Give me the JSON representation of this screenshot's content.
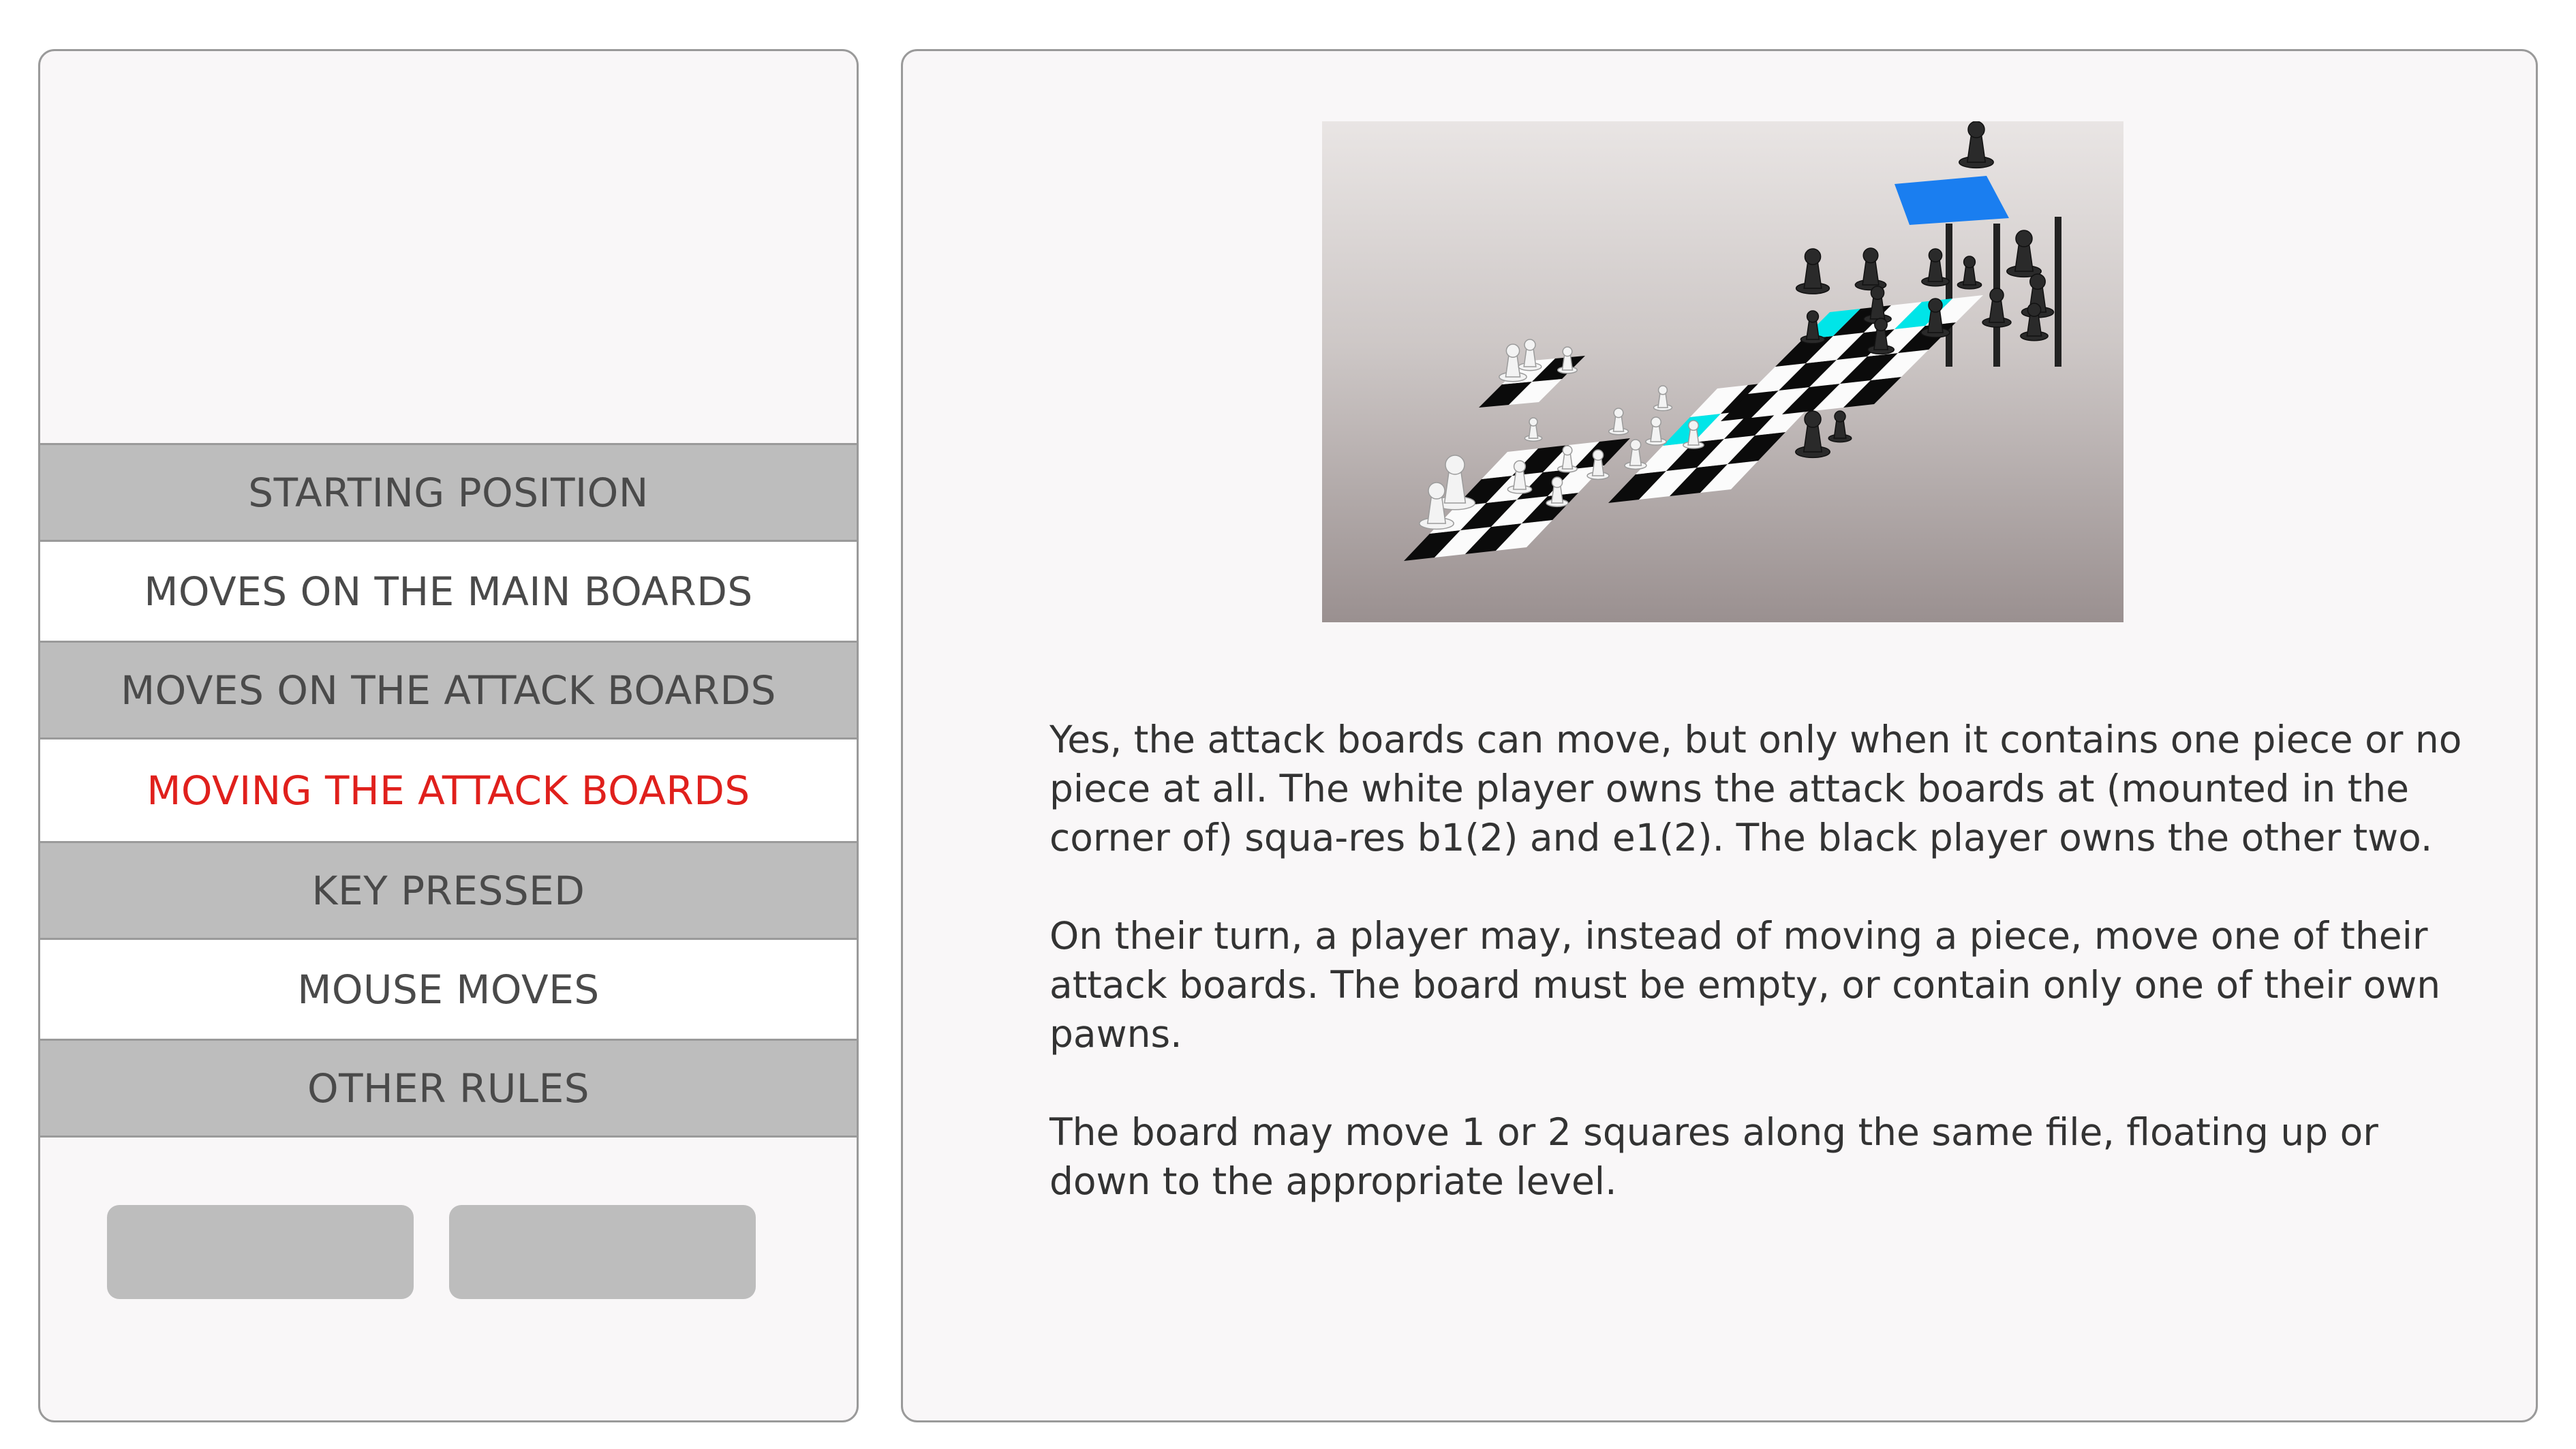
{
  "menu": {
    "items": [
      {
        "label": "STARTING POSITION",
        "active": false
      },
      {
        "label": "MOVES ON THE MAIN BOARDS",
        "active": false
      },
      {
        "label": "MOVES ON THE ATTACK BOARDS",
        "active": false
      },
      {
        "label": "MOVING THE ATTACK BOARDS",
        "active": true
      },
      {
        "label": "KEY PRESSED",
        "active": false
      },
      {
        "label": "MOUSE MOVES",
        "active": false
      },
      {
        "label": "OTHER RULES",
        "active": false
      }
    ]
  },
  "content": {
    "paragraphs": [
      "Yes, the attack boards can move, but only when it contains one piece or no piece at all.  The white player owns the attack boards at (mounted in the corner of) squa-res b1(2) and e1(2).  The black player owns the other two.",
      "On their turn, a player may, instead of moving a piece, move one of their attack boards.  The board must be empty, or contain only one of their own pawns.",
      "The board may move 1 or 2 squares along the same file, floating up or down to the appropriate level."
    ]
  },
  "colors": {
    "active": "#e0201c",
    "menu_shade": "#bdbdbd",
    "highlight_cyan": "#00e5e8",
    "highlight_blue": "#1a7ef0"
  }
}
